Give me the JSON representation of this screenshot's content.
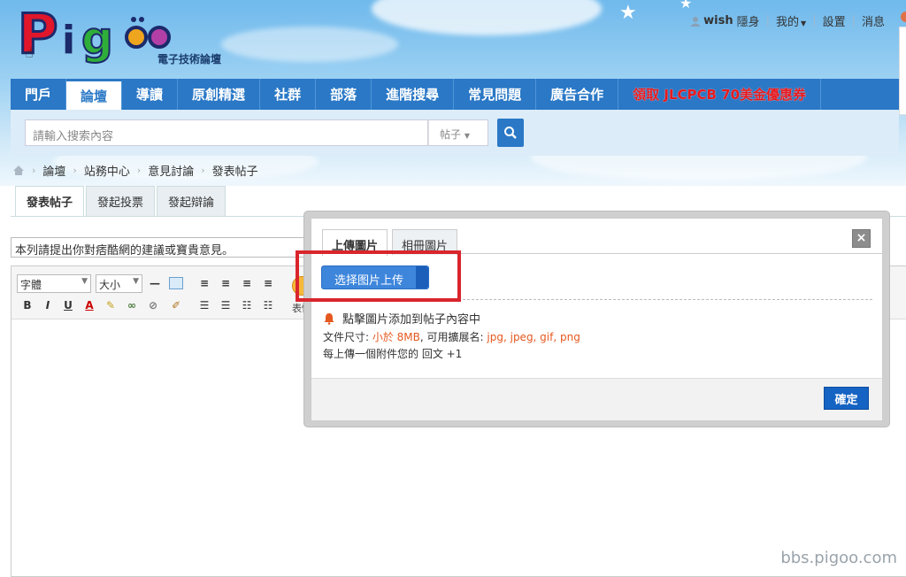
{
  "logo": {
    "text": "Pigoo",
    "subtitle": "電子技術論壇"
  },
  "topbar": {
    "username": "wish",
    "invisible": "隱身",
    "mine": "我的",
    "settings": "設置",
    "messages": "消息"
  },
  "nav": {
    "items": [
      {
        "label": "門戶"
      },
      {
        "label": "論壇",
        "active": true
      },
      {
        "label": "導讀"
      },
      {
        "label": "原創精選"
      },
      {
        "label": "社群"
      },
      {
        "label": "部落"
      },
      {
        "label": "進階搜尋"
      },
      {
        "label": "常見問題"
      },
      {
        "label": "廣告合作"
      },
      {
        "label": "領取 JLCPCB 70美金優惠券",
        "promo": true
      }
    ]
  },
  "search": {
    "placeholder": "請輸入搜索內容",
    "type": "帖子"
  },
  "breadcrumb": [
    "論壇",
    "站務中心",
    "意見討論",
    "發表帖子"
  ],
  "tabs": [
    "發表帖子",
    "發起投票",
    "發起辯論"
  ],
  "subject": {
    "value": "本列請提出你對痞酷網的建議或寶貴意見。"
  },
  "editor": {
    "font_select": "字體",
    "size_select": "大小",
    "emoji_label": "表情"
  },
  "dialog": {
    "tabs": [
      "上傳圖片",
      "相冊圖片"
    ],
    "close": "×",
    "select_button": "选择图片上传",
    "hint": "點擊圖片添加到帖子內容中",
    "size_prefix": "文件尺寸: ",
    "size_value": "小於 8MB",
    "ext_prefix": ", 可用擴展名: ",
    "ext_value": "jpg, jpeg, gif, png",
    "reward": "每上傳一個附件您的 回文 +1",
    "confirm": "確定"
  },
  "watermark": "bbs.pigoo.com",
  "colors": {
    "nav": "#2a78c6",
    "promo": "#e8191d",
    "highlight_box": "#d9252c",
    "accent_text": "#e5581f"
  }
}
